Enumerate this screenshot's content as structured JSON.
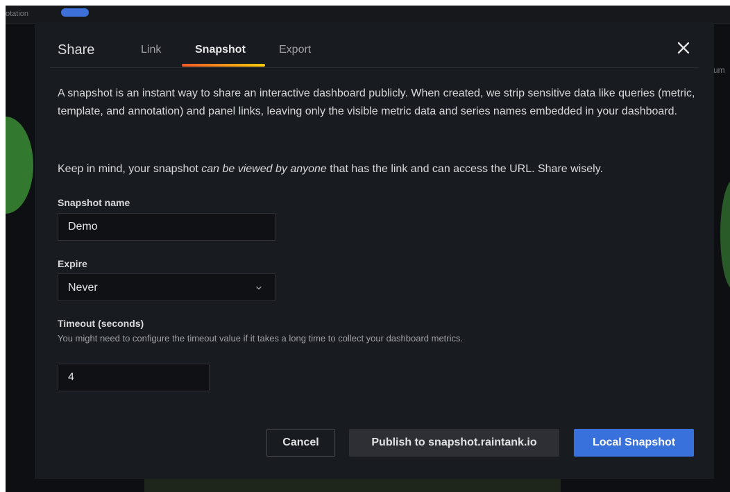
{
  "background": {
    "tab_text": "otation",
    "right_text": "um"
  },
  "modal": {
    "title": "Share",
    "tabs": [
      {
        "label": "Link",
        "active": false
      },
      {
        "label": "Snapshot",
        "active": true
      },
      {
        "label": "Export",
        "active": false
      }
    ],
    "close_icon": "close-icon"
  },
  "description": {
    "paragraph1": "A snapshot is an instant way to share an interactive dashboard publicly. When created, we strip sensitive data like queries (metric, template, and annotation) and panel links, leaving only the visible metric data and series names embedded in your dashboard.",
    "paragraph2_before": "Keep in mind, your snapshot ",
    "paragraph2_emphasis": "can be viewed by anyone",
    "paragraph2_after": " that has the link and can access the URL. Share wisely."
  },
  "form": {
    "snapshot_name": {
      "label": "Snapshot name",
      "value": "Demo"
    },
    "expire": {
      "label": "Expire",
      "value": "Never",
      "icon": "chevron-down-icon"
    },
    "timeout": {
      "label": "Timeout (seconds)",
      "help": "You might need to configure the timeout value if it takes a long time to collect your dashboard metrics.",
      "value": "4"
    }
  },
  "actions": {
    "cancel_label": "Cancel",
    "publish_label": "Publish to snapshot.raintank.io",
    "local_label": "Local Snapshot"
  },
  "colors": {
    "modal_bg": "#181b1f",
    "accent_blue": "#3871dc",
    "tab_underline_start": "#f05a28",
    "tab_underline_end": "#fbca0a"
  }
}
